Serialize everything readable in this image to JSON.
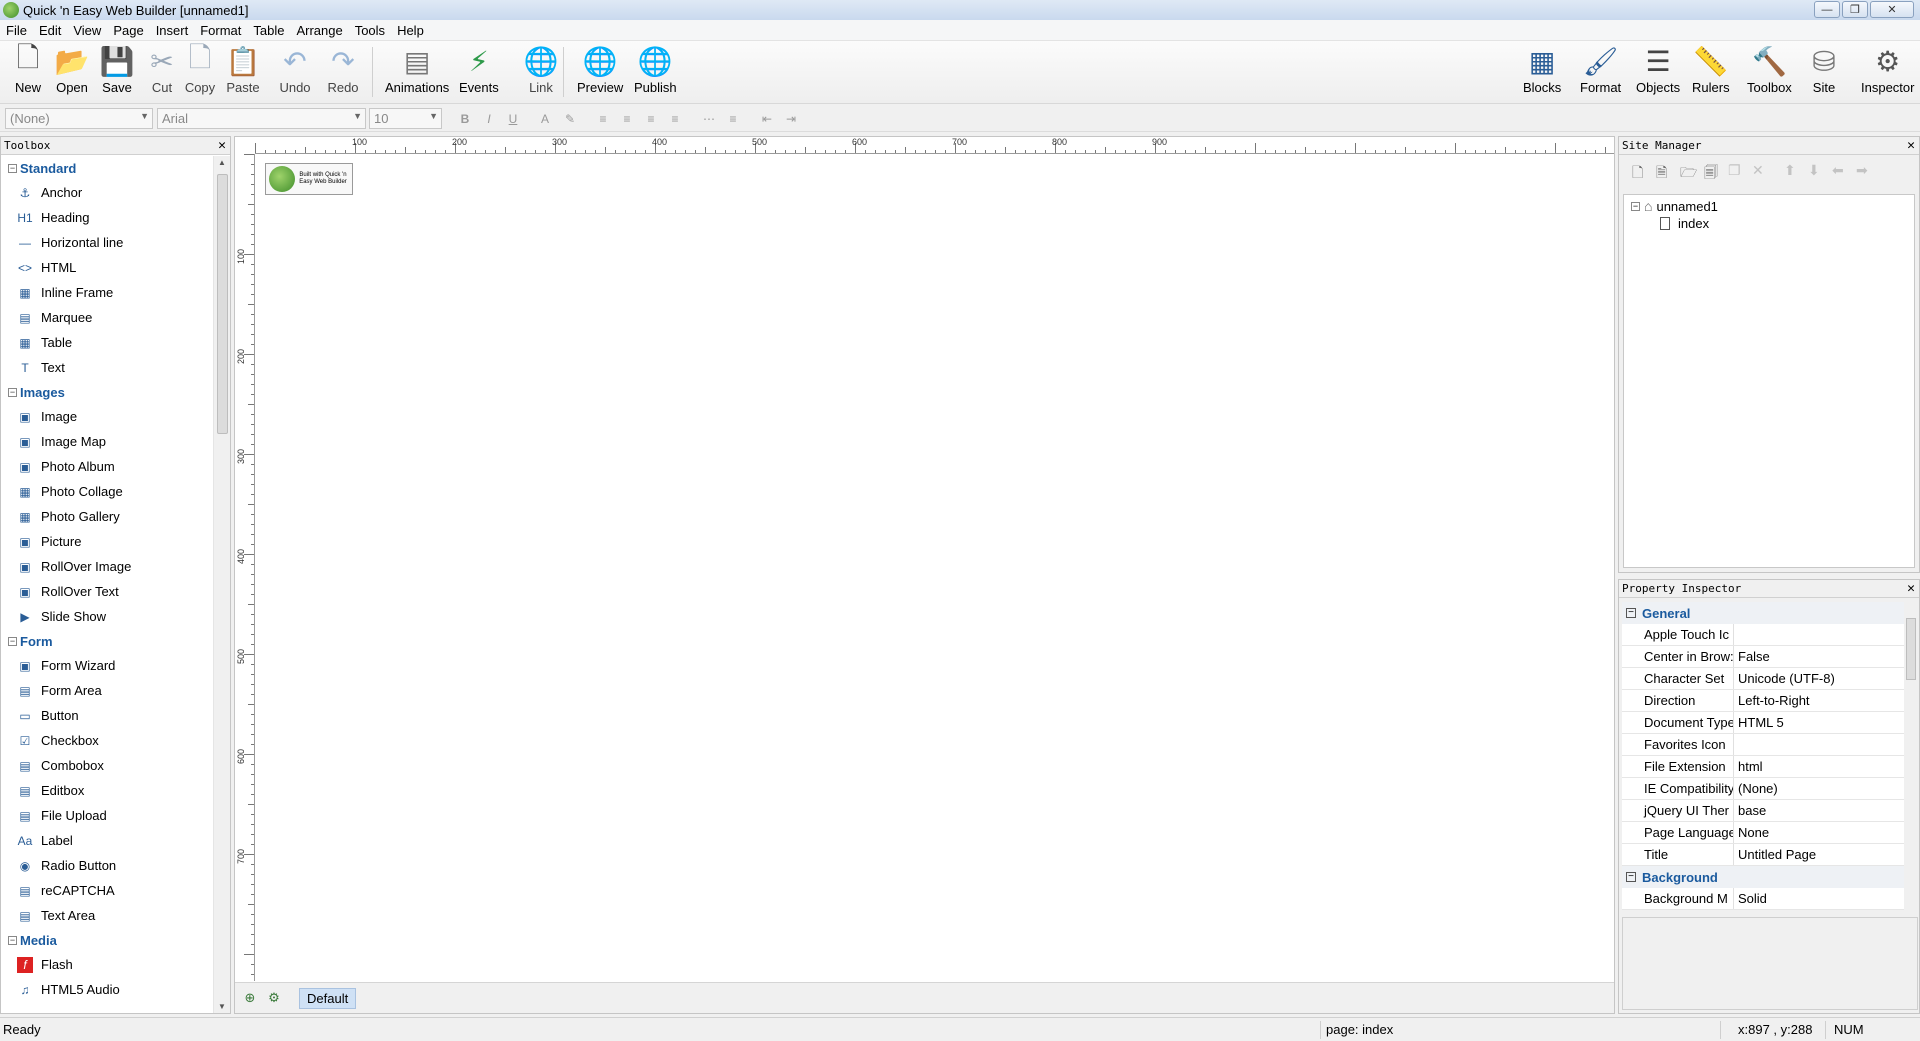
{
  "window": {
    "title": "Quick 'n Easy Web Builder [unnamed1]"
  },
  "menu": [
    "File",
    "Edit",
    "View",
    "Page",
    "Insert",
    "Format",
    "Table",
    "Arrange",
    "Tools",
    "Help"
  ],
  "toolbar": {
    "left": [
      {
        "label": "New",
        "icon": "new-page-icon",
        "enabled": true
      },
      {
        "label": "Open",
        "icon": "folder-open-icon",
        "enabled": true
      },
      {
        "label": "Save",
        "icon": "floppy-save-icon",
        "enabled": true
      },
      {
        "label": "Cut",
        "icon": "scissors-icon",
        "enabled": false
      },
      {
        "label": "Copy",
        "icon": "copy-icon",
        "enabled": false
      },
      {
        "label": "Paste",
        "icon": "clipboard-paste-icon",
        "enabled": false
      },
      {
        "label": "Undo",
        "icon": "undo-arrow-icon",
        "enabled": false
      },
      {
        "label": "Redo",
        "icon": "redo-arrow-icon",
        "enabled": false
      },
      {
        "label": "Animations",
        "icon": "animations-icon",
        "enabled": true
      },
      {
        "label": "Events",
        "icon": "lightning-icon",
        "enabled": true
      },
      {
        "label": "Link",
        "icon": "globe-link-icon",
        "enabled": false
      },
      {
        "label": "Preview",
        "icon": "globe-preview-icon",
        "enabled": true
      },
      {
        "label": "Publish",
        "icon": "globe-publish-icon",
        "enabled": true
      }
    ],
    "right": [
      {
        "label": "Blocks",
        "icon": "blocks-icon"
      },
      {
        "label": "Format",
        "icon": "paintbrush-icon"
      },
      {
        "label": "Objects",
        "icon": "objects-list-icon"
      },
      {
        "label": "Rulers",
        "icon": "ruler-icon"
      },
      {
        "label": "Toolbox",
        "icon": "tools-icon"
      },
      {
        "label": "Site",
        "icon": "site-database-icon"
      },
      {
        "label": "Inspector",
        "icon": "gear-inspector-icon"
      }
    ]
  },
  "format_bar": {
    "style": "(None)",
    "font": "Arial",
    "size": "10"
  },
  "toolbox": {
    "title": "Toolbox",
    "categories": [
      {
        "name": "Standard",
        "items": [
          {
            "label": "Anchor",
            "icon": "anchor-icon"
          },
          {
            "label": "Heading",
            "icon": "heading-icon"
          },
          {
            "label": "Horizontal line",
            "icon": "horizontal-line-icon"
          },
          {
            "label": "HTML",
            "icon": "html-code-icon"
          },
          {
            "label": "Inline Frame",
            "icon": "inline-frame-icon"
          },
          {
            "label": "Marquee",
            "icon": "marquee-icon"
          },
          {
            "label": "Table",
            "icon": "table-icon"
          },
          {
            "label": "Text",
            "icon": "text-icon"
          }
        ]
      },
      {
        "name": "Images",
        "items": [
          {
            "label": "Image",
            "icon": "image-icon"
          },
          {
            "label": "Image Map",
            "icon": "image-map-icon"
          },
          {
            "label": "Photo Album",
            "icon": "photo-album-icon"
          },
          {
            "label": "Photo Collage",
            "icon": "photo-collage-icon"
          },
          {
            "label": "Photo Gallery",
            "icon": "photo-gallery-icon"
          },
          {
            "label": "Picture",
            "icon": "picture-icon"
          },
          {
            "label": "RollOver Image",
            "icon": "rollover-image-icon"
          },
          {
            "label": "RollOver Text",
            "icon": "rollover-text-icon"
          },
          {
            "label": "Slide Show",
            "icon": "slide-show-icon"
          }
        ]
      },
      {
        "name": "Form",
        "items": [
          {
            "label": "Form Wizard",
            "icon": "form-wizard-icon"
          },
          {
            "label": "Form Area",
            "icon": "form-area-icon"
          },
          {
            "label": "Button",
            "icon": "button-icon"
          },
          {
            "label": "Checkbox",
            "icon": "checkbox-icon"
          },
          {
            "label": "Combobox",
            "icon": "combobox-icon"
          },
          {
            "label": "Editbox",
            "icon": "editbox-icon"
          },
          {
            "label": "File Upload",
            "icon": "file-upload-icon"
          },
          {
            "label": "Label",
            "icon": "label-icon"
          },
          {
            "label": "Radio Button",
            "icon": "radio-button-icon"
          },
          {
            "label": "reCAPTCHA",
            "icon": "recaptcha-icon"
          },
          {
            "label": "Text Area",
            "icon": "text-area-icon"
          }
        ]
      },
      {
        "name": "Media",
        "items": [
          {
            "label": "Flash",
            "icon": "flash-icon"
          },
          {
            "label": "HTML5 Audio",
            "icon": "audio-note-icon"
          }
        ]
      }
    ]
  },
  "canvas": {
    "hruler_labels": [
      "100",
      "200",
      "300",
      "400",
      "500",
      "600",
      "700",
      "800",
      "900"
    ],
    "vruler_labels": [
      "100",
      "200",
      "300",
      "400",
      "500",
      "600",
      "700"
    ],
    "badge_text": "Built with Quick 'n Easy Web Builder",
    "tab": "Default"
  },
  "site_manager": {
    "title": "Site Manager",
    "root": "unnamed1",
    "pages": [
      "index"
    ]
  },
  "property_inspector": {
    "title": "Property Inspector",
    "sections": [
      {
        "name": "General",
        "rows": [
          {
            "key": "Apple Touch Ic",
            "value": ""
          },
          {
            "key": "Center in Brow:",
            "value": "False"
          },
          {
            "key": "Character Set",
            "value": "Unicode (UTF-8)"
          },
          {
            "key": "Direction",
            "value": "Left-to-Right"
          },
          {
            "key": "Document Type",
            "value": "HTML 5"
          },
          {
            "key": "Favorites Icon",
            "value": ""
          },
          {
            "key": "File Extension",
            "value": "html"
          },
          {
            "key": "IE Compatibility",
            "value": "(None)"
          },
          {
            "key": "jQuery UI Ther",
            "value": "base"
          },
          {
            "key": "Page Language",
            "value": "None"
          },
          {
            "key": "Title",
            "value": "Untitled Page"
          }
        ]
      },
      {
        "name": "Background",
        "rows": [
          {
            "key": "Background M",
            "value": "Solid"
          }
        ]
      }
    ]
  },
  "status": {
    "left": "Ready",
    "page": "page: index",
    "coords": "x:897 , y:288",
    "num": "NUM"
  }
}
